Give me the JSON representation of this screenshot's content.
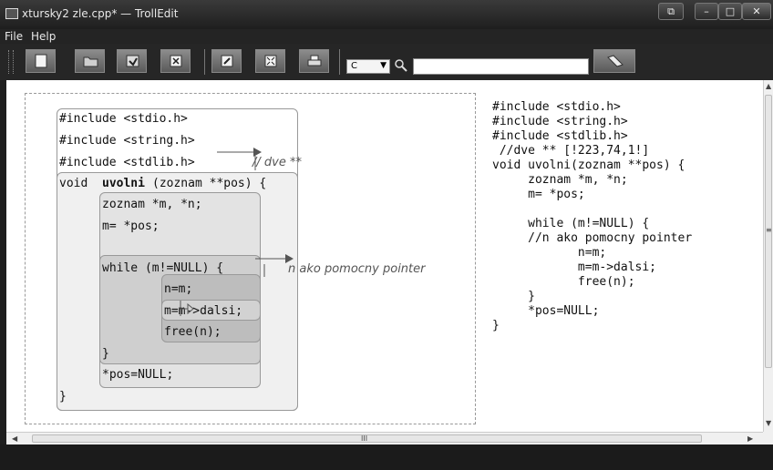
{
  "window": {
    "title": "xtursky2 zle.cpp* — TrollEdit",
    "restore_label": "⧉",
    "minimize_label": "–",
    "maximize_label": "□",
    "close_label": "✕"
  },
  "menu": [
    {
      "label": "File"
    },
    {
      "label": "Help"
    }
  ],
  "toolbar": {
    "buttons": [
      "new-icon",
      "open-icon",
      "save-icon",
      "close-icon",
      "edit-icon",
      "fullscreen-icon",
      "print-icon"
    ],
    "language_select": {
      "value": "C"
    },
    "search": {
      "value": "",
      "placeholder": ""
    },
    "clear_button": "eraser-icon"
  },
  "diagram": {
    "lines": [
      {
        "text": "#include <stdio.h>"
      },
      {
        "text": "#include <string.h>"
      },
      {
        "text": "#include <stdlib.h>"
      },
      {
        "text": "void "
      },
      {
        "text": "uvolni"
      },
      {
        "text": "(zoznam **pos) {"
      },
      {
        "text": "zoznam *m, *n;"
      },
      {
        "text": "m= *pos;"
      },
      {
        "text": "while (m!=NULL) {"
      },
      {
        "text": "n=m;"
      },
      {
        "text": "m=m->dalsi;"
      },
      {
        "text": "free(n);"
      },
      {
        "text": "}"
      },
      {
        "text": "*pos=NULL;"
      },
      {
        "text": "}"
      }
    ],
    "notes": [
      {
        "text": "// dve **"
      },
      {
        "text": "n ako pomocny pointer"
      }
    ]
  },
  "source_code": "#include <stdio.h>\n#include <string.h>\n#include <stdlib.h>\n //dve ** [!223,74,1!]\nvoid uvolni(zoznam **pos) {\n     zoznam *m, *n;\n     m= *pos;\n\n     while (m!=NULL) {\n     //n ako pomocny pointer\n            n=m;\n            m=m->dalsi;\n            free(n);\n     }\n     *pos=NULL;\n}",
  "scrollbars": {
    "h_mid": "III",
    "v_mid": "≡"
  },
  "colors": {
    "block_outer": "#f0f0f0",
    "block_inner": "#e3e3e3",
    "block_loop": "#cfcfcf",
    "block_body": "#bdbdbd"
  }
}
